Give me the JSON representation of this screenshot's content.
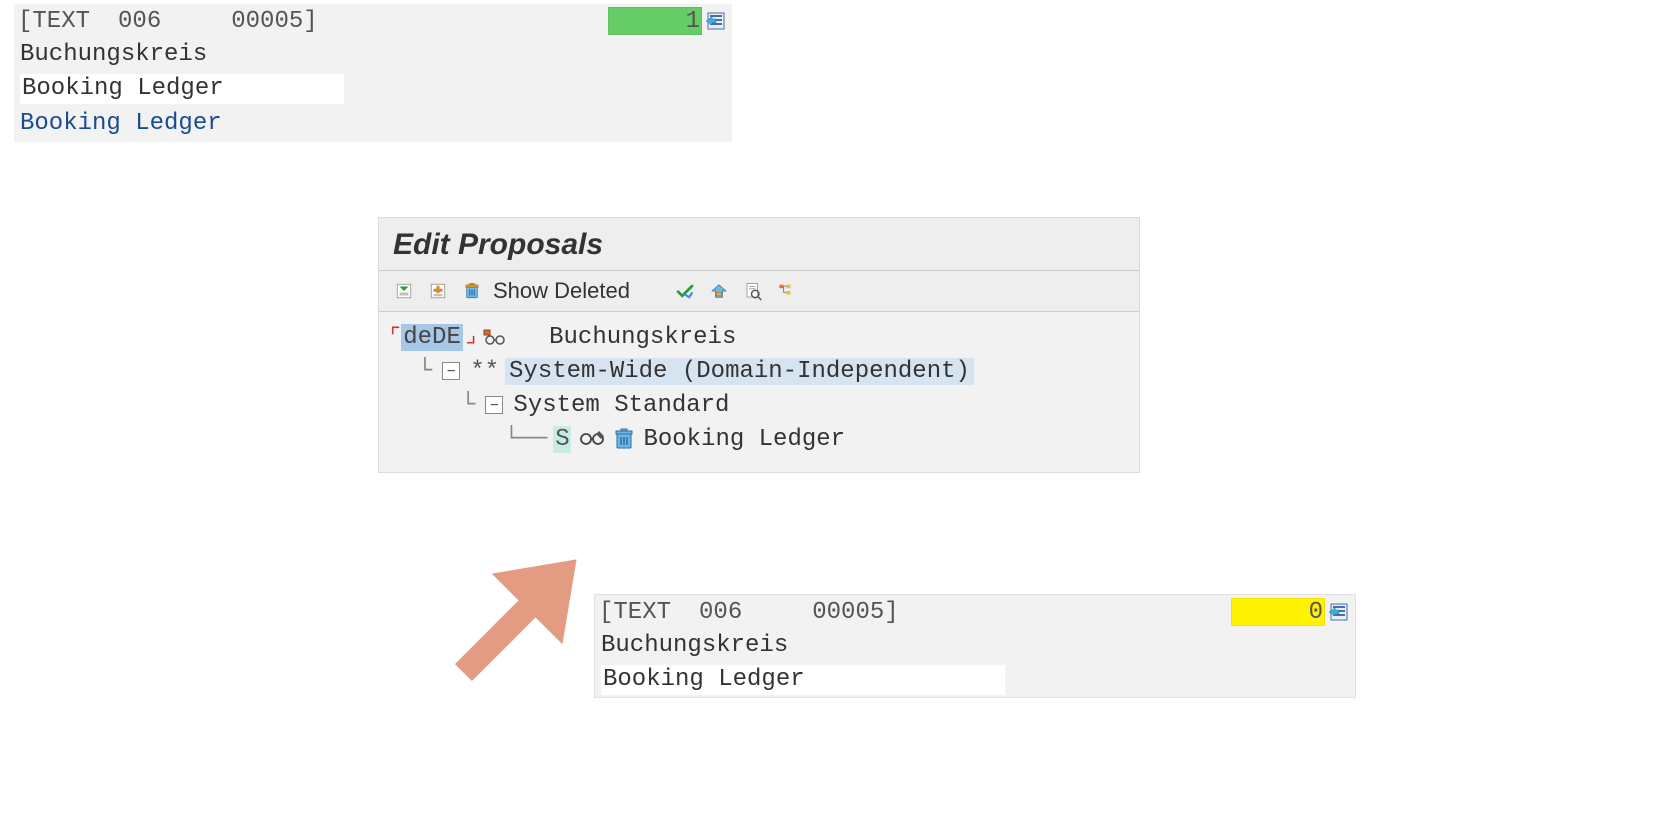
{
  "top_block": {
    "header": {
      "prefix": "[TEXT",
      "iso": "006",
      "code": "00005]",
      "count": "1"
    },
    "german_label": "Buchungskreis",
    "english_edit": "Booking Ledger",
    "english_link": "Booking Ledger"
  },
  "edit_panel": {
    "title": "Edit Proposals",
    "toolbar": {
      "shrink_label": "shrink-icon",
      "expand_label": "expand-icon",
      "trash_label": "trash-icon",
      "show_deleted": "Show Deleted",
      "check_label": "check-icon",
      "shelter_label": "roof-icon",
      "search_doc_label": "find-in-page-icon",
      "hierarchy_label": "hierarchy-icon"
    },
    "tree": {
      "lang_code": "deDE",
      "root_label": "Buchungskreis",
      "domain_prefix": "**",
      "domain_label": "System-Wide (Domain-Independent)",
      "standard_label": "System Standard",
      "leaf_badge": "S",
      "leaf_label": "Booking Ledger"
    }
  },
  "bottom_block": {
    "header": {
      "prefix": "[TEXT",
      "iso": "006",
      "code": "00005]",
      "count": "0"
    },
    "german_label": "Buchungskreis",
    "english_edit": "Booking Ledger"
  }
}
